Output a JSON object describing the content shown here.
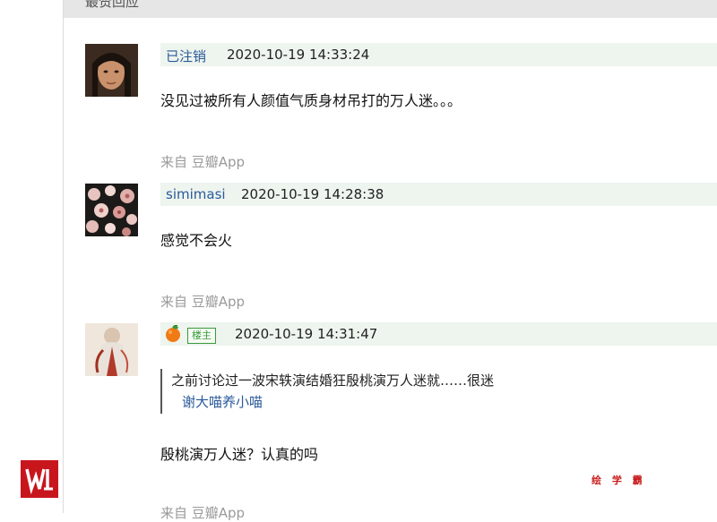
{
  "header": {
    "title": "最赞回应"
  },
  "comments": [
    {
      "author": "已注销",
      "time": "2020-10-19 14:33:24",
      "content": "没见过被所有人颜值气质身材吊打的万人迷。。。",
      "source": "来自 豆瓣App"
    },
    {
      "author": "simimasi",
      "time": "2020-10-19 14:28:38",
      "content": "感觉不会火",
      "source": "来自 豆瓣App"
    },
    {
      "host_badge": "楼主",
      "time": "2020-10-19 14:31:47",
      "quote": {
        "text": "之前讨论过一波宋轶演结婚狂殷桃演万人迷就……很迷",
        "author": "谢大喵养小喵"
      },
      "content": "殷桃演万人迷？认真的吗",
      "source": "来自 豆瓣App"
    }
  ],
  "watermark": "绘 学 霸",
  "icons": {
    "host_avatar_icon": "orange-icon",
    "logo": "w-logo"
  }
}
